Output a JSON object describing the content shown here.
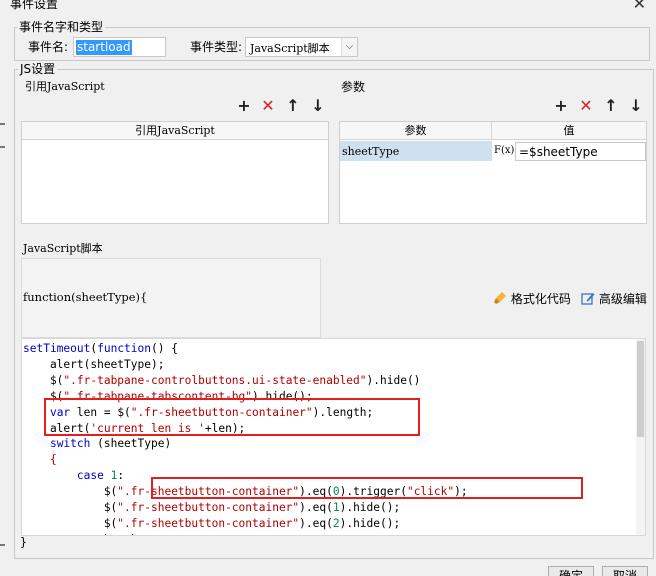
{
  "window": {
    "title": "事件设置",
    "close_glyph": "✕"
  },
  "event_group": {
    "legend": "事件名字和类型",
    "name_label": "事件名:",
    "name_value": "startload",
    "type_label": "事件类型:",
    "type_value": "JavaScript脚本",
    "type_arrow": "⌵"
  },
  "js_group": {
    "legend": "JS设置"
  },
  "ref_js": {
    "title": "引用JavaScript",
    "column_header": "引用JavaScript",
    "toolbar": {
      "add": "+",
      "delete": "✕",
      "up": "↑",
      "down": "↓"
    }
  },
  "params": {
    "title": "参数",
    "toolbar": {
      "add": "+",
      "delete": "✕",
      "up": "↑",
      "down": "↓"
    },
    "columns": [
      "参数",
      "值"
    ],
    "rows": [
      {
        "name": "sheetType",
        "formula_icon": "F(x)",
        "value": "=$sheetType"
      }
    ]
  },
  "script": {
    "title": "JavaScript脚本",
    "signature": "function(sheetType){",
    "format_label": "格式化代码",
    "advanced_label": "高级编辑",
    "closing_brace": "}",
    "lines": [
      "setTimeout(function() {",
      "    alert(sheetType);",
      "    $(\".fr-tabpane-controlbuttons.ui-state-enabled\").hide()",
      "    $(\".fr-tabpane-tabscontent-bg\").hide();",
      "    var len = $(\".fr-sheetbutton-container\").length;",
      "    alert('current len is '+len);",
      "    switch (sheetType)",
      "    {",
      "        case 1:",
      "            $(\".fr-sheetbutton-container\").eq(0).trigger(\"click\");",
      "            $(\".fr-sheetbutton-container\").eq(1).hide();",
      "            $(\".fr-sheetbutton-container\").eq(2).hide();",
      "            break;"
    ]
  },
  "footer": {
    "ok_label": "确定",
    "cancel_label": "取消"
  },
  "colors": {
    "highlight": "#e02020",
    "keyword": "#0000cc",
    "string": "#b30000",
    "selection": "#3399ff"
  }
}
